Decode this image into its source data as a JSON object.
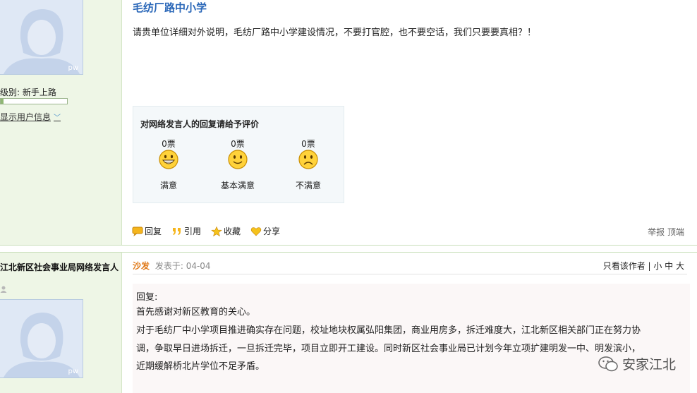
{
  "post1": {
    "author": {
      "level_label": "级别: 新手上路",
      "show_info": "显示用户信息",
      "avatar_tag": "pw",
      "level_progress": 0.04
    },
    "title": "毛纺厂路中小学",
    "body": "请贵单位详细对外说明，毛纺厂路中小学建设情况，不要打官腔，也不要空话，我们只要要真相？！",
    "rating": {
      "title": "对网络发言人的回复请给予评价",
      "options": [
        {
          "votes": "0票",
          "label": "满意",
          "icon": "grin-face-icon"
        },
        {
          "votes": "0票",
          "label": "基本满意",
          "icon": "smile-face-icon"
        },
        {
          "votes": "0票",
          "label": "不满意",
          "icon": "sad-face-icon"
        }
      ]
    },
    "actions": {
      "reply": "回复",
      "quote": "引用",
      "favorite": "收藏",
      "share": "分享"
    },
    "tools": {
      "report": "举报",
      "top": "顶端"
    }
  },
  "post2": {
    "author_name": "江北新区社会事业局网络发言人",
    "avatar_tag": "pw",
    "floor": "沙发",
    "posted": "发表于: 04-04",
    "tools": "只看该作者 | 小 中 大",
    "reply_lines": [
      "回复:",
      "首先感谢对新区教育的关心。",
      "对于毛纺厂中小学项目推进确实存在问题，校址地块权属弘阳集团，商业用房多，拆迁难度大，江北新区相关部门正在努力协",
      "调，争取早日进场拆迁，一旦拆迁完毕，项目立即开工建设。同时新区社会事业局已计划今年立项扩建明发一中、明发滨小，",
      "近期缓解桥北片学位不足矛盾。"
    ]
  },
  "watermark": "安家江北",
  "colors": {
    "sidebar_bg": "#eef6e6",
    "title_blue": "#2a67b8",
    "floor_orange": "#e07a1a",
    "rating_bg": "#f4f8fa"
  }
}
